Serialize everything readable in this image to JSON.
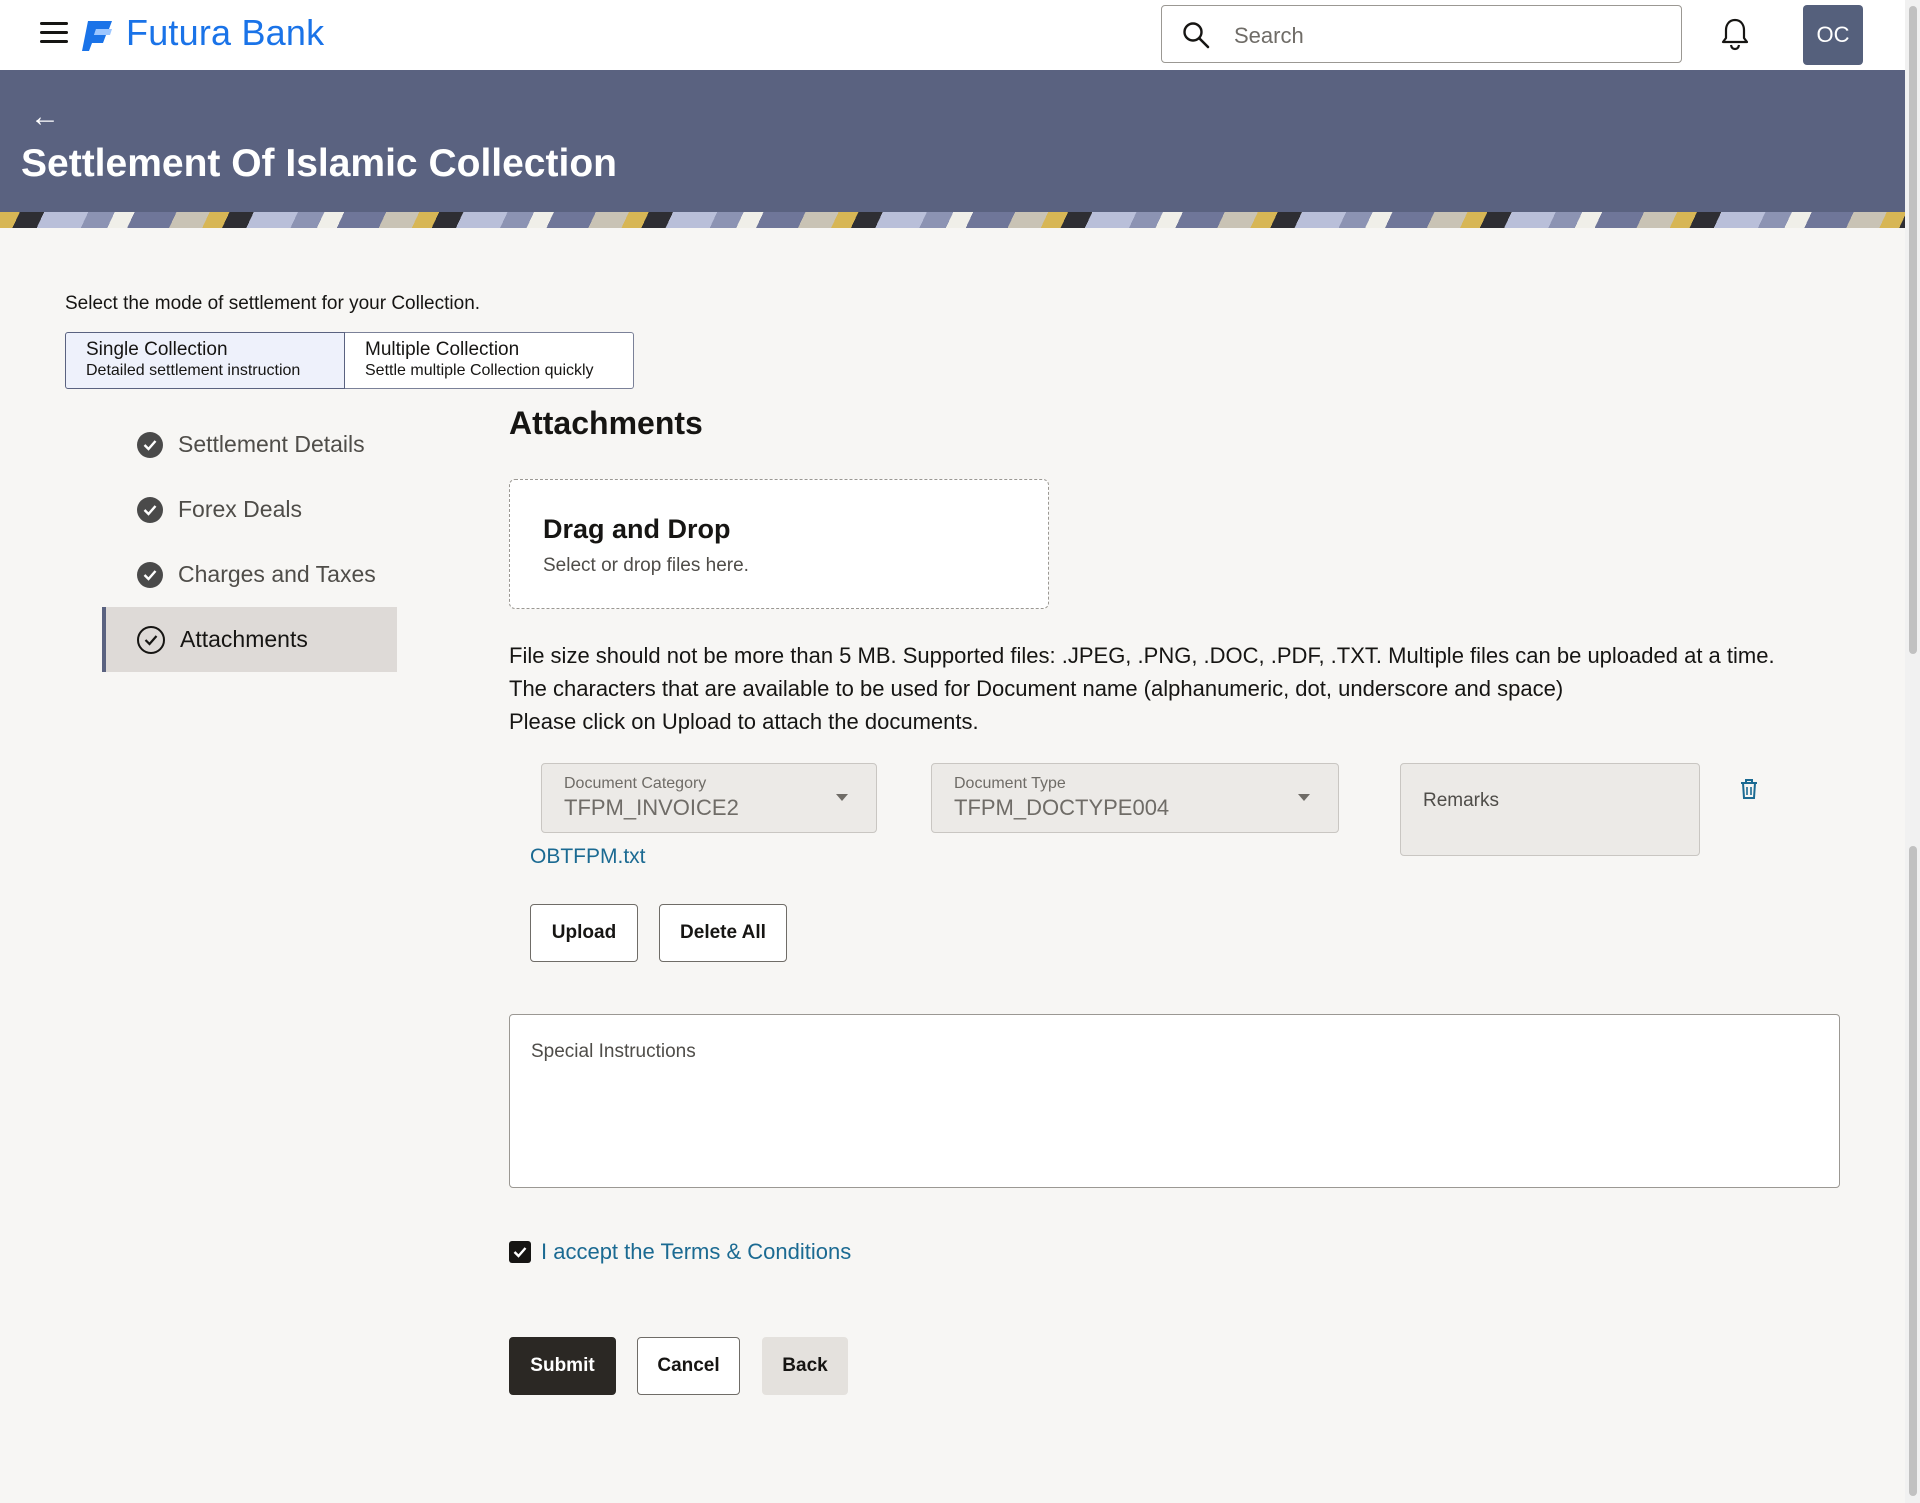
{
  "header": {
    "brand": "Futura Bank",
    "search_placeholder": "Search",
    "avatar_initials": "OC"
  },
  "banner": {
    "title": "Settlement Of Islamic Collection"
  },
  "mode": {
    "prompt": "Select the mode of settlement for your Collection.",
    "options": [
      {
        "title": "Single Collection",
        "subtitle": "Detailed settlement instruction",
        "selected": true
      },
      {
        "title": "Multiple Collection",
        "subtitle": "Settle multiple Collection quickly",
        "selected": false
      }
    ]
  },
  "steps": [
    {
      "label": "Settlement Details",
      "status": "complete"
    },
    {
      "label": "Forex Deals",
      "status": "complete"
    },
    {
      "label": "Charges and Taxes",
      "status": "complete"
    },
    {
      "label": "Attachments",
      "status": "current"
    }
  ],
  "attachments": {
    "title": "Attachments",
    "dropzone_title": "Drag and Drop",
    "dropzone_subtitle": "Select or drop files here.",
    "info_lines": [
      "File size should not be more than 5 MB. Supported files: .JPEG, .PNG, .DOC, .PDF, .TXT. Multiple files can be uploaded at a time.",
      "The characters that are available to be used for Document name (alphanumeric, dot, underscore and space)",
      "Please click on Upload to attach the documents."
    ],
    "document_category_label": "Document Category",
    "document_category_value": "TFPM_INVOICE2",
    "document_type_label": "Document Type",
    "document_type_value": "TFPM_DOCTYPE004",
    "remarks_label": "Remarks",
    "file_name": "OBTFPM.txt",
    "upload_label": "Upload",
    "delete_all_label": "Delete All"
  },
  "special_instructions_label": "Special Instructions",
  "terms_label": "I accept the Terms & Conditions",
  "terms_checked": true,
  "actions": {
    "submit": "Submit",
    "cancel": "Cancel",
    "back": "Back"
  },
  "colors": {
    "brand": "#1a73e8",
    "banner": "#5a6280",
    "link": "#1b6a92",
    "primary_button": "#2b2824"
  }
}
